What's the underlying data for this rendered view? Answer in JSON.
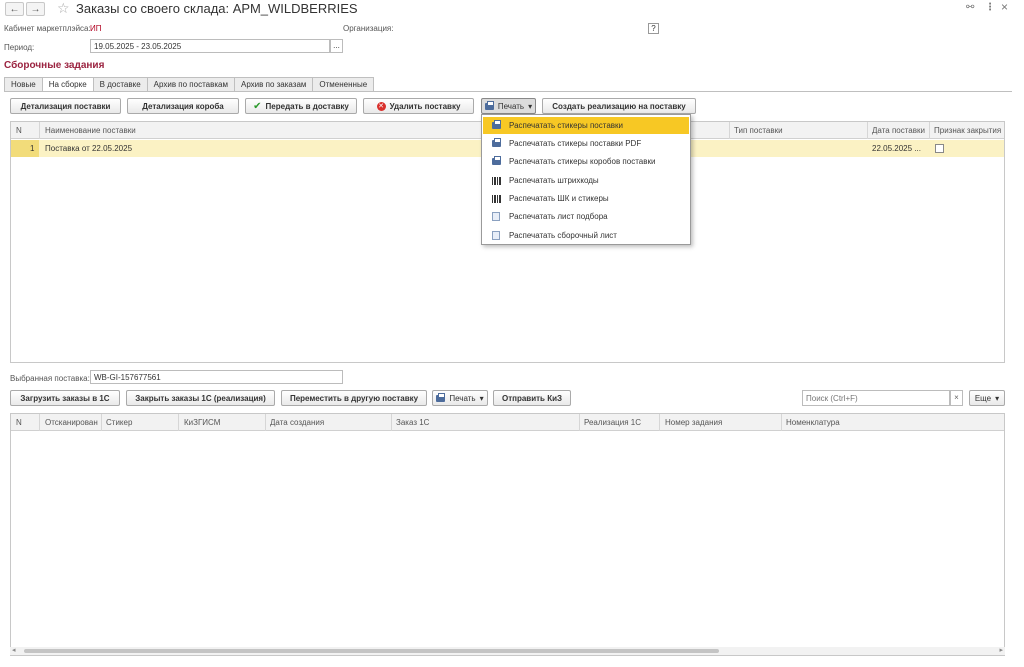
{
  "window": {
    "title": "Заказы со своего склада: АРМ_WILDBERRIES",
    "back_glyph": "←",
    "forward_glyph": "→",
    "link_glyph": "🔗",
    "more_glyph": "⋮",
    "close_glyph": "×"
  },
  "header": {
    "cabinet_label": "Кабинет маркетплэйса:",
    "cabinet_value": "ИП",
    "organization_label": "Организация:",
    "help_label": "?",
    "period_label": "Период:",
    "period_value": "19.05.2025 - 23.05.2025",
    "period_button": "..."
  },
  "section_title": "Сборочные задания",
  "tabs": [
    "Новые",
    "На сборке",
    "В доставке",
    "Архив по поставкам",
    "Архив по заказам",
    "Отмененные"
  ],
  "active_tab": "На сборке",
  "toolbar": {
    "detail_supply": "Детализация поставки",
    "detail_box": "Детализация короба",
    "send_delivery": "Передать в доставку",
    "delete_supply": "Удалить поставку",
    "print": "Печать",
    "create_sale": "Создать реализацию на поставку"
  },
  "print_menu": {
    "items": [
      {
        "label": "Распечатать стикеры поставки",
        "icon": "printer-icon"
      },
      {
        "label": "Распечатать стикеры поставки PDF",
        "icon": "printer-icon"
      },
      {
        "label": "Распечатать стикеры коробов поставки",
        "icon": "printer-icon"
      },
      {
        "label": "Распечатать штрихкоды",
        "icon": "barcode-icon"
      },
      {
        "label": "Распечатать ШК и стикеры",
        "icon": "barcode-icon"
      },
      {
        "label": "Распечатать лист подбора",
        "icon": "document-icon"
      },
      {
        "label": "Распечатать сборочный лист",
        "icon": "document-icon"
      }
    ],
    "highlighted": "Распечатать стикеры поставки"
  },
  "supplies_table": {
    "columns": [
      "N",
      "Наименование поставки",
      "Тип поставки",
      "Дата поставки",
      "Признак закрытия"
    ],
    "rows": [
      {
        "n": "1",
        "name": "Поставка от 22.05.2025",
        "type": "",
        "date": "22.05.2025 ...",
        "closed": false
      }
    ]
  },
  "selected_supply": {
    "label": "Выбранная поставка:",
    "value": "WB-GI-157677561"
  },
  "orders_toolbar": {
    "load_orders": "Загрузить заказы в 1С",
    "close_orders": "Закрыть заказы 1С (реализация)",
    "move_supply": "Переместить в другую поставку",
    "print": "Печать",
    "send_kiz": "Отправить КиЗ",
    "search_placeholder": "Поиск (Ctrl+F)",
    "clear_glyph": "×",
    "more": "Еще"
  },
  "orders_table": {
    "columns": [
      "N",
      "Отсканирован",
      "Стикер",
      "КиЗГИСМ",
      "Дата создания",
      "Заказ 1С",
      "Реализация 1С",
      "Номер задания",
      "Номенклатура"
    ],
    "rows": []
  }
}
